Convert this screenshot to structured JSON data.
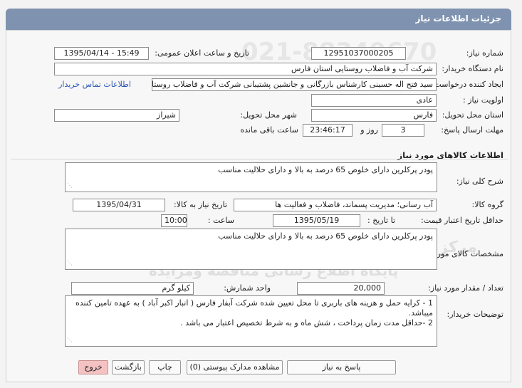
{
  "header": {
    "title": "جزئیات اطلاعات نیاز"
  },
  "fields": {
    "need_number_label": "شماره نیاز:",
    "need_number": "12951037000205",
    "announce_label": "تاریخ و ساعت اعلان عمومی:",
    "announce_value": "1395/04/14 - 15:49",
    "buyer_org_label": "نام دستگاه خریدار:",
    "buyer_org": "شرکت آب و فاضلاب روستایی استان فارس",
    "requester_label": "ایجاد کننده درخواست:",
    "requester": "سید فتح اله  حسینی  کارشناس بازرگانی و جانشین پشتیبانی شرکت آب و فاضلاب روستایی استان فارس",
    "contact_link": "اطلاعات تماس خریدار",
    "priority_label": "اولویت نیاز :",
    "priority": "عادی",
    "province_label": "استان محل تحویل:",
    "province": "فارس",
    "city_label": "شهر محل تحویل:",
    "city": "شیراز",
    "deadline_label": "مهلت ارسال پاسخ:",
    "days_value": "3",
    "days_word": "روز و",
    "time_left": "23:46:17",
    "time_left_label": "ساعت باقی مانده"
  },
  "goods": {
    "section_title": "اطلاعات کالاهای مورد نیاز",
    "general_desc_label": "شرح کلی نیاز:",
    "general_desc": "پودر پرکلرین دارای خلوص 65 درصد به بالا و دارای حلالیت مناسب",
    "group_label": "گروه کالا:",
    "group_value": "آب رسانی؛ مدیریت پسماند، فاضلاب و فعالیت ها",
    "need_date_label": "تاریخ نیاز به کالا:",
    "need_date": "1395/04/31",
    "min_validity_label": "حداقل تاریخ اعتبار قیمت:",
    "until_date_label": "تا تاریخ :",
    "until_date": "1395/05/19",
    "hour_label": "ساعت :",
    "hour_value": "10:00",
    "specs_label": "مشخصات کالای مورد نیاز:",
    "specs": "پودر پرکلرین دارای خلوص 65 درصد به بالا و دارای حلالیت مناسب",
    "quantity_label": "تعداد / مقدار مورد نیاز:",
    "quantity": "20,000",
    "unit_label": "واحد شمارش:",
    "unit_value": "کیلو گرم",
    "buyer_notes_label": "توضیحات خریدار:",
    "buyer_notes_1": "1 - کرایه حمل و هزینه های باربری تا محل تعیین شده شرکت آبفار فارس ( انبار اکبر آباد ) به عهده تامین کننده میباشد.",
    "buyer_notes_2": "2 -حداقل مدت زمان پرداخت ، شش ماه و به شرط تخصیص اعتبار می باشد ."
  },
  "buttons": {
    "reply": "پاسخ به نیاز",
    "attachments": "مشاهده مدارک پیوستی (0)",
    "print": "چاپ",
    "back": "بازگشت",
    "exit": "خروج"
  },
  "watermark": {
    "line1": "مرکز فراوری اطلاعات پارس نماد داده ها",
    "line2": "پایگاه اطلاع رسانی مناقصه ومزایده",
    "phone": "021-88349670"
  },
  "colors": {
    "titlebar": "#7f93b0",
    "exit_button": "#f4c2c2",
    "link": "#2a55b4"
  }
}
